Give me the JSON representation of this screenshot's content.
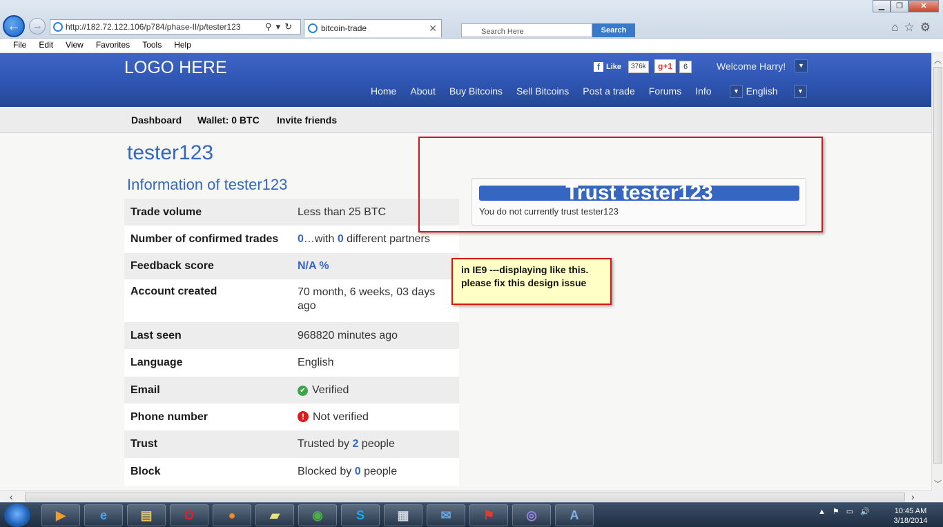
{
  "browser": {
    "address": "http://182.72.122.106/p784/phase-II/p/tester123",
    "tab_title": "bitcoin-trade",
    "tab_close": "✕",
    "address_tools": "⚲▾↻",
    "search_placeholder": "Search Here",
    "search_button": "Search",
    "back_glyph": "←",
    "forward_glyph": "→",
    "window_min": "▁",
    "window_max": "❐",
    "window_close": "✕",
    "right_icons": "⌂☆⚙",
    "menu": [
      "File",
      "Edit",
      "View",
      "Favorites",
      "Tools",
      "Help"
    ]
  },
  "site": {
    "logo": "LOGO HERE",
    "fb_like": "Like",
    "fb_count": "376k",
    "gplus": "g+1",
    "gplus_count": "6",
    "welcome": "Welcome Harry!",
    "nav": [
      "Home",
      "About",
      "Buy Bitcoins",
      "Sell Bitcoins",
      "Post a trade",
      "Forums",
      "Info",
      "English"
    ],
    "subnav": {
      "dashboard": "Dashboard",
      "wallet": "Wallet: 0 BTC",
      "invite": "Invite friends"
    }
  },
  "profile": {
    "username": "tester123",
    "info_heading": "Information of tester123",
    "rows": {
      "trade_volume": {
        "label": "Trade volume",
        "value": "Less than 25 BTC"
      },
      "confirmed_trades": {
        "label": "Number of confirmed trades",
        "count": "0",
        "mid": "…with ",
        "partners": "0",
        "suffix": " different partners"
      },
      "feedback": {
        "label": "Feedback score",
        "value": "N/A %"
      },
      "account_created": {
        "label": "Account created",
        "value": "70 month, 6 weeks, 03 days ago"
      },
      "last_seen": {
        "label": "Last seen",
        "value": "968820 minutes ago"
      },
      "language": {
        "label": "Language",
        "value": "English"
      },
      "email": {
        "label": "Email",
        "value": "Verified"
      },
      "phone": {
        "label": "Phone number",
        "value": "Not verified"
      },
      "trust": {
        "label": "Trust",
        "prefix": "Trusted by ",
        "count": "2",
        "suffix": " people"
      },
      "block": {
        "label": "Block",
        "prefix": "Blocked by ",
        "count": "0",
        "suffix": " people"
      }
    }
  },
  "trust_box": {
    "title": "Trust tester123",
    "text": "You do not currently trust tester123"
  },
  "annotation": {
    "line1": "in IE9 ---displaying like this.",
    "line2": "please fix this design issue"
  },
  "taskbar": {
    "tray": "▲⚑▭🔊",
    "time": "10:45 AM",
    "date": "3/18/2014",
    "apps": [
      "media-player",
      "internet-explorer",
      "file-explorer",
      "opera",
      "firefox",
      "sticky-notes",
      "chrome",
      "skype",
      "task-manager",
      "thunderbird",
      "adobe-reader",
      "app-swirl",
      "wordpad"
    ]
  },
  "colors": {
    "header_blue": "#2f55b3",
    "link_blue": "#3466c2",
    "annotation_red": "#d01a1a",
    "note_yellow": "#ffffc6"
  }
}
